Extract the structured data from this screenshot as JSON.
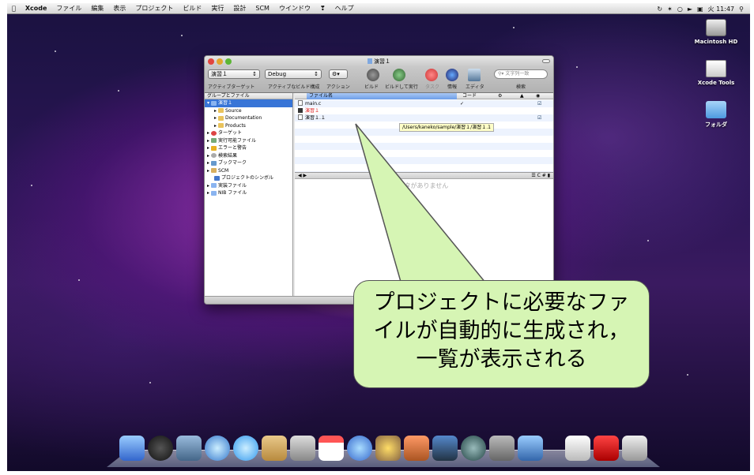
{
  "menubar": {
    "app_name": "Xcode",
    "menus": [
      "ファイル",
      "編集",
      "表示",
      "プロジェクト",
      "ビルド",
      "実行",
      "設計",
      "SCM",
      "ウインドウ",
      "ヘルプ"
    ],
    "clock": "火 11:47"
  },
  "desktop": {
    "icons": [
      "Macintosh HD",
      "Xcode Tools",
      "フォルダ"
    ]
  },
  "window": {
    "title": "演習１",
    "toolbar": {
      "target_popup": "演習１",
      "config_popup": "Debug",
      "labels": [
        "アクティブターゲット",
        "アクティブなビルド構成",
        "アクション",
        "ビルド",
        "ビルドして実行",
        "タスク",
        "情報",
        "エディタ",
        "検索"
      ],
      "search_placeholder": "文字列一致"
    },
    "sidebar": {
      "header": "グループとファイル",
      "items": [
        "演習１",
        "Source",
        "Documentation",
        "Products",
        "ターゲット",
        "実行可能ファイル",
        "エラーと警告",
        "検索結果",
        "ブックマーク",
        "SCM",
        "プロジェクトのシンボル",
        "実装ファイル",
        "NIB ファイル"
      ]
    },
    "files": {
      "header_name": "ファイル名",
      "header_code": "コード",
      "rows": [
        "main.c",
        "演習１",
        "演習１.１"
      ]
    },
    "tooltip": "/Users/kaneko/sample/演習１/演習１.1",
    "editor_empty": "エディタがありません"
  },
  "callout": {
    "lines": [
      "プロジェクトに必要なファ",
      "イルが自動的に生成され，",
      "一覧が表示される"
    ]
  },
  "colors": {
    "callout_fill": "#d6f5b4",
    "selection": "#3875d7"
  }
}
